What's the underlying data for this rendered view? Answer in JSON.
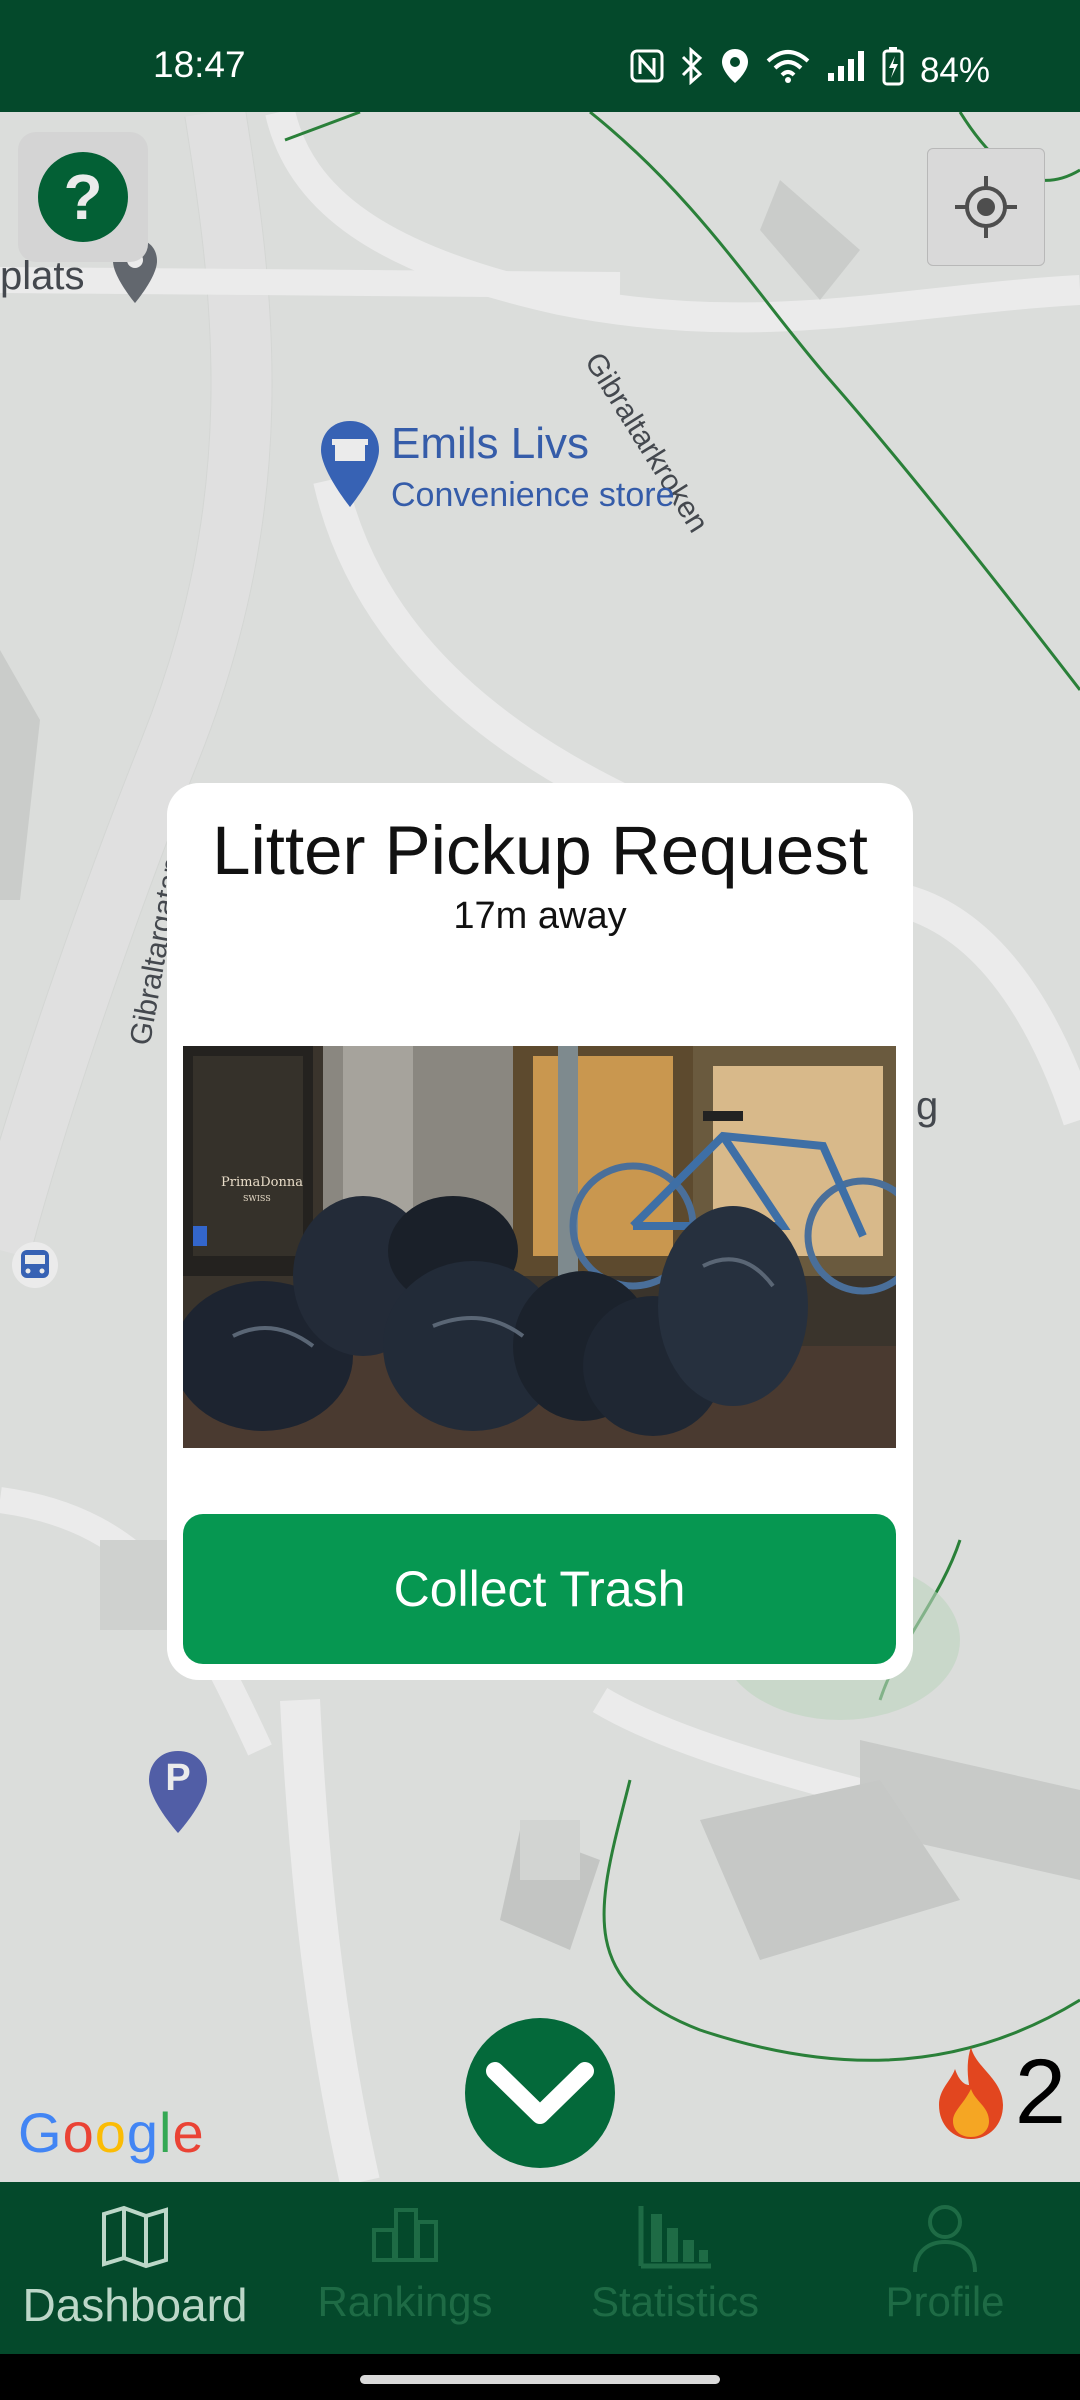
{
  "status_bar": {
    "time": "18:47",
    "battery": "84%",
    "icons": [
      "nfc-icon",
      "bluetooth-icon",
      "location-icon",
      "wifi-icon",
      "signal-icon",
      "battery-charging-icon"
    ]
  },
  "map": {
    "labels": {
      "plats": "plats",
      "street_1": "Gibraltarkroken",
      "street_2": "Gibraltargatan",
      "place_name": "Emils Livs",
      "place_type": "Convenience store",
      "edge_fragment": "g",
      "parking": "P"
    },
    "google": "Google"
  },
  "modal": {
    "title": "Litter Pickup Request",
    "distance": "17m away",
    "photo": {
      "storefront_sign_1": "PrimaDonna",
      "storefront_sign_2": "SWISS"
    },
    "button": "Collect Trash"
  },
  "streak": {
    "count": "2"
  },
  "navbar": {
    "items": [
      {
        "label": "Dashboard",
        "active": true
      },
      {
        "label": "Rankings",
        "active": false
      },
      {
        "label": "Statistics",
        "active": false
      },
      {
        "label": "Profile",
        "active": false
      }
    ]
  },
  "colors": {
    "brand_dark": "#04492b",
    "brand_green": "#069751",
    "fab_green": "#04693a",
    "nav_inactive": "#1e6b45"
  }
}
